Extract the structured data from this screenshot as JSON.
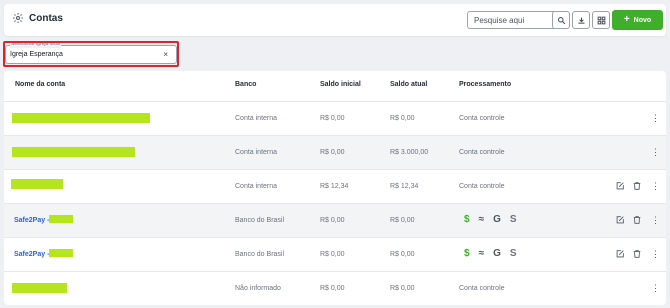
{
  "header": {
    "title": "Contas",
    "search_placeholder": "Pesquise aqui",
    "new_button_label": "Novo",
    "accent_color": "#3fae2a"
  },
  "church_filter": {
    "legend": "Selecionar igreja local",
    "value": "Igreja Esperança",
    "clear_icon": "×"
  },
  "table": {
    "columns": [
      "Nome da conta",
      "Banco",
      "Saldo inicial",
      "Saldo atual",
      "Processamento"
    ],
    "rows": [
      {
        "name": "",
        "bank": "Conta interna",
        "initial": "R$ 0,00",
        "current": "R$ 0,00",
        "processing": "Conta controle",
        "actions": false,
        "kebab": "⋮"
      },
      {
        "name": "",
        "bank": "Conta interna",
        "initial": "R$ 0,00",
        "current": "R$ 3.000,00",
        "processing": "Conta controle",
        "actions": false,
        "kebab": "⋮"
      },
      {
        "name": "",
        "bank": "Conta interna",
        "initial": "R$ 12,34",
        "current": "R$ 12,34",
        "processing": "Conta controle",
        "actions": true,
        "kebab": "⋮"
      },
      {
        "name": "Safe2Pay - ",
        "bank": "Banco do Brasil",
        "initial": "R$ 0,00",
        "current": "R$ 0,00",
        "processing": "",
        "actions": true,
        "kebab": "⋮"
      },
      {
        "name": "Safe2Pay - ",
        "bank": "Banco do Brasil",
        "initial": "R$ 0,00",
        "current": "R$ 0,00",
        "processing": "",
        "actions": true,
        "kebab": "⋮"
      },
      {
        "name": "",
        "bank": "Não informado",
        "initial": "R$ 0,00",
        "current": "R$ 0,00",
        "processing": "Conta controle",
        "actions": false,
        "kebab": "⋮"
      }
    ],
    "processing_icons": [
      "$",
      "≈",
      "G",
      "S"
    ]
  },
  "colors": {
    "redaction": "#b5e61d",
    "link": "#2563eb",
    "highlight_border": "#dc2626"
  }
}
